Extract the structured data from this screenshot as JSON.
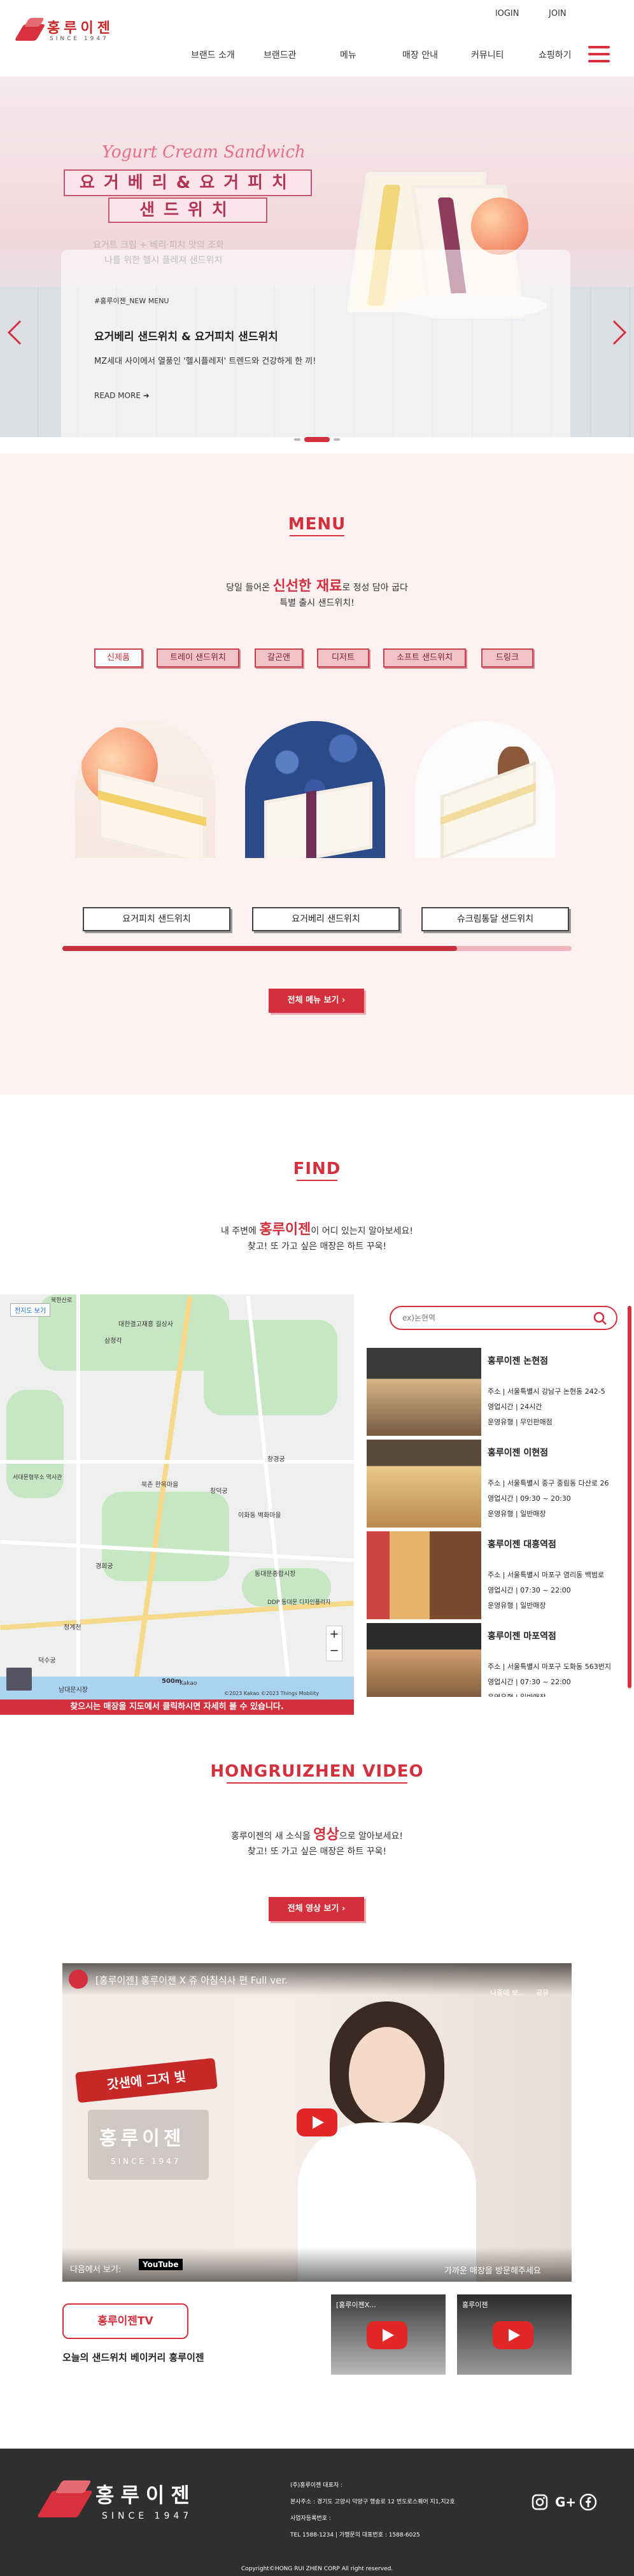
{
  "header": {
    "logo_name": "홍루이젠",
    "logo_since": "SINCE 1947",
    "login": "lOGIN",
    "join": "JOIN",
    "nav": [
      "브랜드 소개",
      "브랜드관",
      "메뉴",
      "매장 안내",
      "커뮤니티",
      "쇼핑하기"
    ]
  },
  "hero": {
    "script": "Yogurt Cream Sandwich",
    "title_line1": "요거베리&요거피치",
    "title_line2": "샌드위치",
    "faint_line1": "요거트 크림 + 베리·피치 맛의 조화",
    "faint_line2": "나를 위한 헬시 플레져 샌드위치",
    "tag": "#홍루이젠_NEW MENU",
    "headline": "요거베리 샌드위치 & 요거피치 샌드위치",
    "desc": "MZ세대 사이에서 열풍인 '헬시플레저' 트렌드와 건강하게 한 끼!",
    "more": "READ MORE"
  },
  "menu": {
    "title": "MENU",
    "sub_pre": "당일 들어온 ",
    "sub_em": "신선한 재료",
    "sub_post": "로 정성 담아 굽다",
    "sub_line2": "특별 출시 샌드위치!",
    "chips": [
      "신제품",
      "트레이 샌드위치",
      "갈곤앤",
      "디저트",
      "소프트 샌드위치",
      "드링크"
    ],
    "products": [
      "요거피치 샌드위치",
      "요거베리 샌드위치",
      "슈크림통달 샌드위치"
    ],
    "all_button": "전체 메뉴 보기"
  },
  "find": {
    "title": "FIND",
    "sub_pre": "내 주변에 ",
    "sub_em": "홍루이젠",
    "sub_post": "이 어디 있는지 알아보세요!",
    "sub_line2": "찾고! 또 가고 싶은 매장은 하트 꾸욱!",
    "search_placeholder": "ex)논현역",
    "map_caption": "찾으시는 매장을 지도에서 클릭하시면 자세히 볼 수 있습니다.",
    "map_view_btn": "전지도 보기",
    "map_credit": "Kakao",
    "map_copy": "©2023 Kakao ©2023 Things Mobility",
    "map_scale": "500m",
    "stores": [
      {
        "name": "홍루이젠 논현점",
        "addr": "주소 | 서울특별시 강남구 논현동 242-5",
        "hours": "영업시간 | 24시간",
        "type": "운영유형 | 무인판매점"
      },
      {
        "name": "홍루이젠 이현점",
        "addr": "주소 | 서울특별시 중구 중림동 다산로 26",
        "hours": "영업시간 | 09:30 ~ 20:30",
        "type": "운영유형 | 일반매장"
      },
      {
        "name": "홍루이젠 대흥역점",
        "addr": "주소 | 서울특별시 마포구 염리동 백범로",
        "hours": "영업시간 | 07:30 ~ 22:00",
        "type": "운영유형 | 일반매장"
      },
      {
        "name": "홍루이젠 마포역점",
        "addr": "주소 | 서울특별시 마포구 도화동 563번지",
        "hours": "영업시간 | 07:30 ~ 22:00",
        "type": "운영유형 | 일반매장"
      }
    ],
    "map_labels": [
      "북한산로",
      "대한결고재흥 길상사",
      "삼청각",
      "창경궁",
      "경희궁",
      "서대문형무소 역사관",
      "북촌 한옥마을",
      "창덕궁",
      "이화동 벽화마을",
      "동대문종합시장",
      "DDP 동대문 디자인플라자",
      "덕수궁",
      "청계천",
      "남대문시장"
    ]
  },
  "video": {
    "title": "HONGRUIZHEN VIDEO",
    "sub_pre": "홍루이젠의 새 소식을 ",
    "sub_em": "영상",
    "sub_post": "으로 알아보세요!",
    "sub_line2": "찾고! 또 가고 싶은 매장은 하트 꾸욱!",
    "all_button": "전체 영상 보기",
    "main_title": "[홍루이젠] 홍루이젠 X 쥬 아침식사 편 Full ver.",
    "watch_later": "나중에 보...",
    "share": "공유",
    "banner": "갓샌에 그저 빛",
    "overlay_brand": "홍루이젠",
    "overlay_since": "SINCE 1947",
    "watch_on": "다음에서 보기:",
    "youtube": "YouTube",
    "corner_text": "가까운 매장을 방문해주세요",
    "thumb1_title": "[홍루이젠X...",
    "thumb2_title": "홍루이젠",
    "tv_button": "홍루이젠TV",
    "tagline": "오늘의 샌드위치 베이커리 홍루이젠"
  },
  "footer": {
    "brand": "홍루이젠",
    "since": "SINCE 1947",
    "lines": [
      "(주)홍루이젠 대표자 :",
      "본사주소 : 경기도 고양시 덕양구 행송로 12 번도로스퀘어 지1,지2호",
      "사업자등록번호 :",
      "TEL 1588-1234 | 가맹문의 대표번호 : 1588-6025"
    ],
    "copyright": "Copyright©HONG RUI ZHEN CORP All right reserved.",
    "social": [
      "instagram-icon",
      "google-plus-icon",
      "facebook-icon"
    ]
  },
  "colors": {
    "brand": "#d32f3c",
    "menu_bg": "#fdf1f2",
    "footer_bg": "#2f2f2f"
  }
}
